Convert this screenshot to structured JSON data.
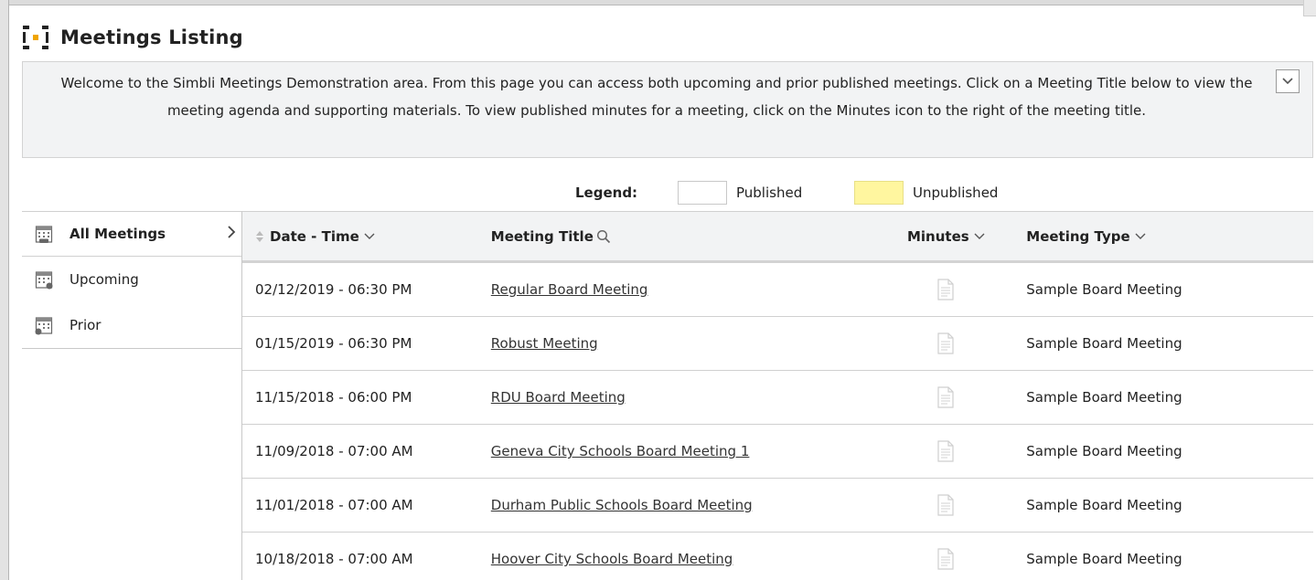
{
  "page": {
    "title": "Meetings Listing"
  },
  "welcome": {
    "text": "Welcome to the Simbli Meetings Demonstration area.  From this page you can access both upcoming and prior published meetings.  Click on a Meeting Title below to view the meeting agenda and supporting materials.  To view published minutes for a meeting, click on the Minutes icon to the right of the meeting title."
  },
  "legend": {
    "label": "Legend:",
    "published": "Published",
    "unpublished": "Unpublished",
    "published_color": "#ffffff",
    "unpublished_color": "#fff69f"
  },
  "sidebar": {
    "items": [
      {
        "label": "All Meetings",
        "icon": "calendar-all-icon",
        "active": true
      },
      {
        "label": "Upcoming",
        "icon": "calendar-upcoming-icon",
        "active": false
      },
      {
        "label": "Prior",
        "icon": "calendar-prior-icon",
        "active": false
      }
    ]
  },
  "table": {
    "headers": {
      "date": "Date - Time",
      "title": "Meeting Title",
      "minutes": "Minutes",
      "type": "Meeting Type"
    },
    "rows": [
      {
        "date": "02/12/2019 - 06:30 PM",
        "title": "Regular Board Meeting",
        "type": "Sample Board Meeting"
      },
      {
        "date": "01/15/2019 - 06:30 PM",
        "title": "Robust Meeting",
        "type": "Sample Board Meeting"
      },
      {
        "date": "11/15/2018 - 06:00 PM",
        "title": "RDU Board Meeting",
        "type": "Sample Board Meeting"
      },
      {
        "date": "11/09/2018 - 07:00 AM",
        "title": "Geneva City Schools Board Meeting 1",
        "type": "Sample Board Meeting"
      },
      {
        "date": "11/01/2018 - 07:00 AM",
        "title": "Durham Public Schools Board Meeting",
        "type": "Sample Board Meeting"
      },
      {
        "date": "10/18/2018 - 07:00 AM",
        "title": "Hoover City Schools Board Meeting",
        "type": "Sample Board Meeting"
      }
    ]
  }
}
